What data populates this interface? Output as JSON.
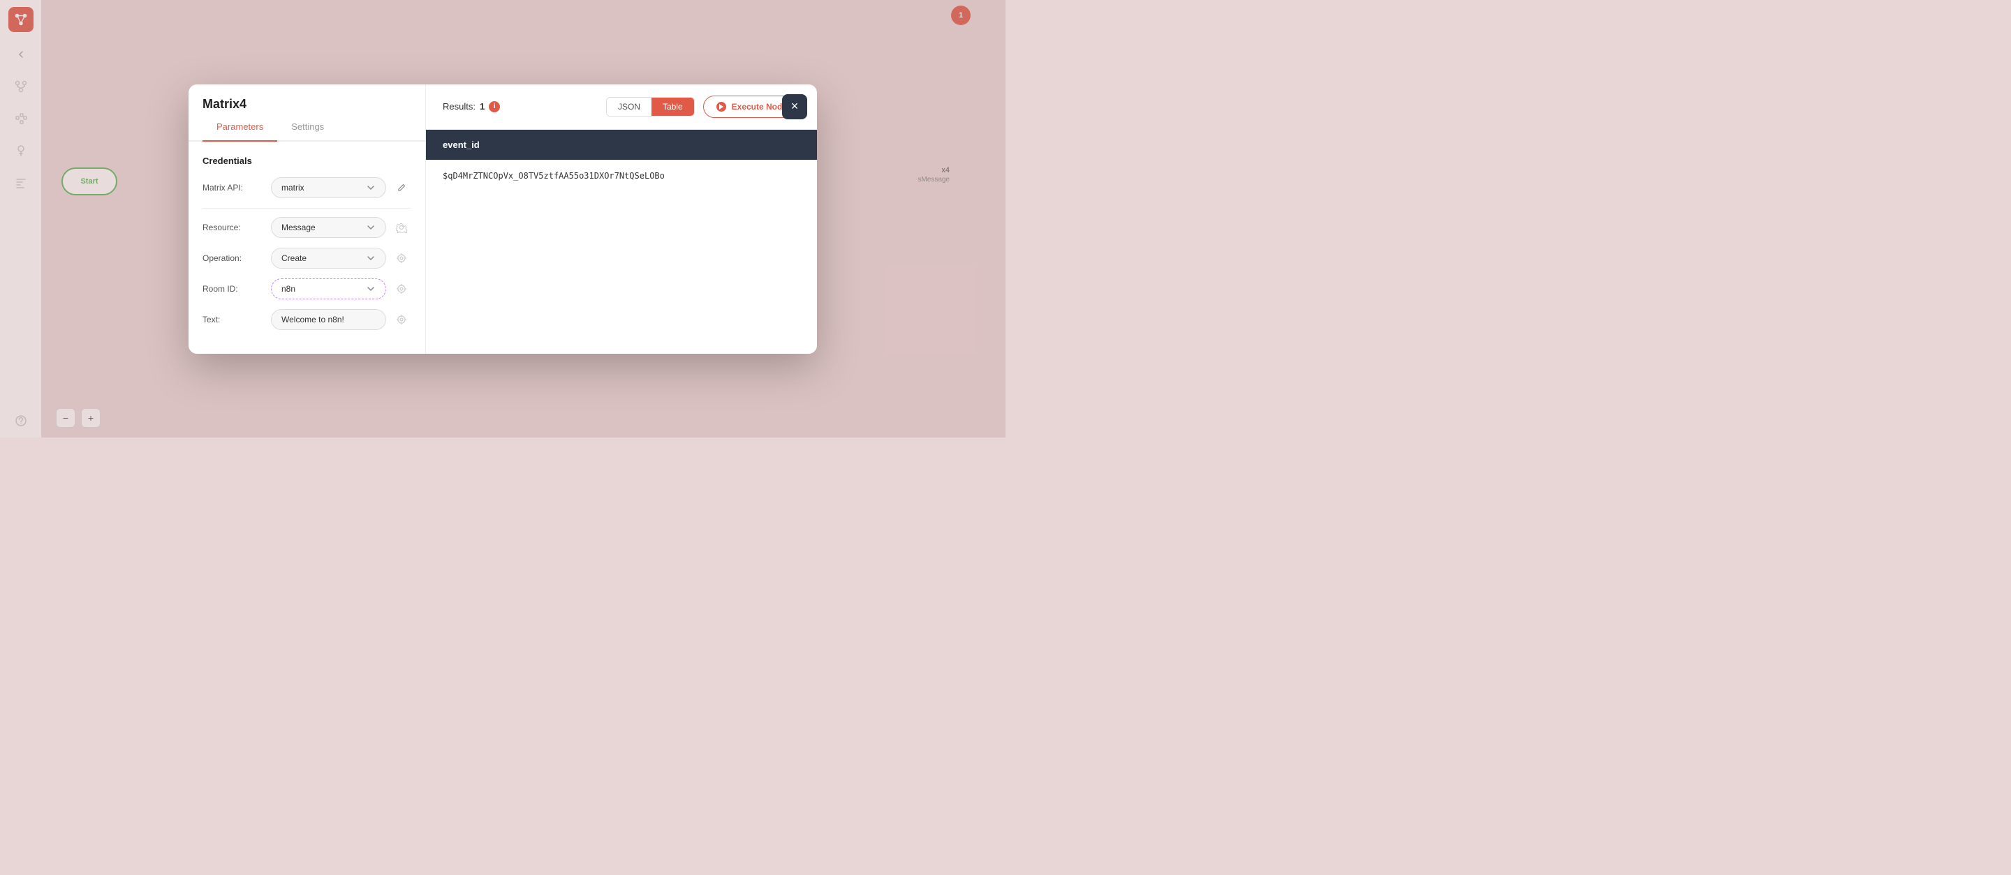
{
  "sidebar": {
    "logo_alt": "n8n logo",
    "arrow_label": "collapse",
    "items": [
      {
        "name": "workflows-icon",
        "label": "Workflows"
      },
      {
        "name": "nodes-icon",
        "label": "Nodes"
      },
      {
        "name": "credentials-icon",
        "label": "Credentials"
      },
      {
        "name": "executions-icon",
        "label": "Executions"
      },
      {
        "name": "help-icon",
        "label": "Help"
      }
    ]
  },
  "modal": {
    "title": "Matrix4",
    "close_label": "×",
    "tabs": [
      {
        "id": "parameters",
        "label": "Parameters",
        "active": true
      },
      {
        "id": "settings",
        "label": "Settings",
        "active": false
      }
    ],
    "credentials_section": "Credentials",
    "fields": {
      "matrix_api": {
        "label": "Matrix API:",
        "value": "matrix",
        "has_edit": true
      },
      "resource": {
        "label": "Resource:",
        "value": "Message",
        "has_settings": true
      },
      "operation": {
        "label": "Operation:",
        "value": "Create",
        "has_settings": true
      },
      "room_id": {
        "label": "Room ID:",
        "value": "n8n",
        "has_settings": true,
        "dashed": true
      },
      "text": {
        "label": "Text:",
        "value": "Welcome to n8n!",
        "has_settings": true
      }
    },
    "results": {
      "label": "Results:",
      "count": "1",
      "views": [
        {
          "id": "json",
          "label": "JSON",
          "active": false
        },
        {
          "id": "table",
          "label": "Table",
          "active": true
        }
      ],
      "execute_label": "Execute Node",
      "table_header": "event_id",
      "table_value": "$qD4MrZTNCOpVx_O8TV5ztfAA55o31DXOr7NtQSeLOBo"
    }
  },
  "background": {
    "start_node_label": "Start",
    "matrix_node_label": "x4",
    "matrix_node_sublabel": "sMessage"
  },
  "zoom": {
    "in_label": "+",
    "out_label": "−"
  }
}
